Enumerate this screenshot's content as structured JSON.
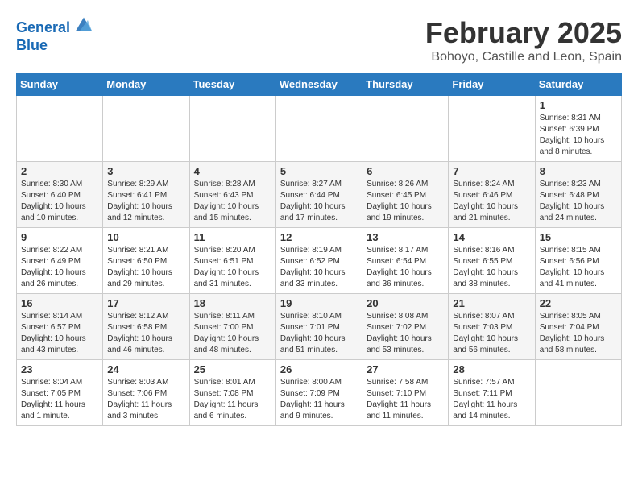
{
  "header": {
    "logo_line1": "General",
    "logo_line2": "Blue",
    "month": "February 2025",
    "location": "Bohoyo, Castille and Leon, Spain"
  },
  "days_of_week": [
    "Sunday",
    "Monday",
    "Tuesday",
    "Wednesday",
    "Thursday",
    "Friday",
    "Saturday"
  ],
  "weeks": [
    [
      {
        "day": "",
        "info": ""
      },
      {
        "day": "",
        "info": ""
      },
      {
        "day": "",
        "info": ""
      },
      {
        "day": "",
        "info": ""
      },
      {
        "day": "",
        "info": ""
      },
      {
        "day": "",
        "info": ""
      },
      {
        "day": "1",
        "info": "Sunrise: 8:31 AM\nSunset: 6:39 PM\nDaylight: 10 hours and 8 minutes."
      }
    ],
    [
      {
        "day": "2",
        "info": "Sunrise: 8:30 AM\nSunset: 6:40 PM\nDaylight: 10 hours and 10 minutes."
      },
      {
        "day": "3",
        "info": "Sunrise: 8:29 AM\nSunset: 6:41 PM\nDaylight: 10 hours and 12 minutes."
      },
      {
        "day": "4",
        "info": "Sunrise: 8:28 AM\nSunset: 6:43 PM\nDaylight: 10 hours and 15 minutes."
      },
      {
        "day": "5",
        "info": "Sunrise: 8:27 AM\nSunset: 6:44 PM\nDaylight: 10 hours and 17 minutes."
      },
      {
        "day": "6",
        "info": "Sunrise: 8:26 AM\nSunset: 6:45 PM\nDaylight: 10 hours and 19 minutes."
      },
      {
        "day": "7",
        "info": "Sunrise: 8:24 AM\nSunset: 6:46 PM\nDaylight: 10 hours and 21 minutes."
      },
      {
        "day": "8",
        "info": "Sunrise: 8:23 AM\nSunset: 6:48 PM\nDaylight: 10 hours and 24 minutes."
      }
    ],
    [
      {
        "day": "9",
        "info": "Sunrise: 8:22 AM\nSunset: 6:49 PM\nDaylight: 10 hours and 26 minutes."
      },
      {
        "day": "10",
        "info": "Sunrise: 8:21 AM\nSunset: 6:50 PM\nDaylight: 10 hours and 29 minutes."
      },
      {
        "day": "11",
        "info": "Sunrise: 8:20 AM\nSunset: 6:51 PM\nDaylight: 10 hours and 31 minutes."
      },
      {
        "day": "12",
        "info": "Sunrise: 8:19 AM\nSunset: 6:52 PM\nDaylight: 10 hours and 33 minutes."
      },
      {
        "day": "13",
        "info": "Sunrise: 8:17 AM\nSunset: 6:54 PM\nDaylight: 10 hours and 36 minutes."
      },
      {
        "day": "14",
        "info": "Sunrise: 8:16 AM\nSunset: 6:55 PM\nDaylight: 10 hours and 38 minutes."
      },
      {
        "day": "15",
        "info": "Sunrise: 8:15 AM\nSunset: 6:56 PM\nDaylight: 10 hours and 41 minutes."
      }
    ],
    [
      {
        "day": "16",
        "info": "Sunrise: 8:14 AM\nSunset: 6:57 PM\nDaylight: 10 hours and 43 minutes."
      },
      {
        "day": "17",
        "info": "Sunrise: 8:12 AM\nSunset: 6:58 PM\nDaylight: 10 hours and 46 minutes."
      },
      {
        "day": "18",
        "info": "Sunrise: 8:11 AM\nSunset: 7:00 PM\nDaylight: 10 hours and 48 minutes."
      },
      {
        "day": "19",
        "info": "Sunrise: 8:10 AM\nSunset: 7:01 PM\nDaylight: 10 hours and 51 minutes."
      },
      {
        "day": "20",
        "info": "Sunrise: 8:08 AM\nSunset: 7:02 PM\nDaylight: 10 hours and 53 minutes."
      },
      {
        "day": "21",
        "info": "Sunrise: 8:07 AM\nSunset: 7:03 PM\nDaylight: 10 hours and 56 minutes."
      },
      {
        "day": "22",
        "info": "Sunrise: 8:05 AM\nSunset: 7:04 PM\nDaylight: 10 hours and 58 minutes."
      }
    ],
    [
      {
        "day": "23",
        "info": "Sunrise: 8:04 AM\nSunset: 7:05 PM\nDaylight: 11 hours and 1 minute."
      },
      {
        "day": "24",
        "info": "Sunrise: 8:03 AM\nSunset: 7:06 PM\nDaylight: 11 hours and 3 minutes."
      },
      {
        "day": "25",
        "info": "Sunrise: 8:01 AM\nSunset: 7:08 PM\nDaylight: 11 hours and 6 minutes."
      },
      {
        "day": "26",
        "info": "Sunrise: 8:00 AM\nSunset: 7:09 PM\nDaylight: 11 hours and 9 minutes."
      },
      {
        "day": "27",
        "info": "Sunrise: 7:58 AM\nSunset: 7:10 PM\nDaylight: 11 hours and 11 minutes."
      },
      {
        "day": "28",
        "info": "Sunrise: 7:57 AM\nSunset: 7:11 PM\nDaylight: 11 hours and 14 minutes."
      },
      {
        "day": "",
        "info": ""
      }
    ]
  ]
}
